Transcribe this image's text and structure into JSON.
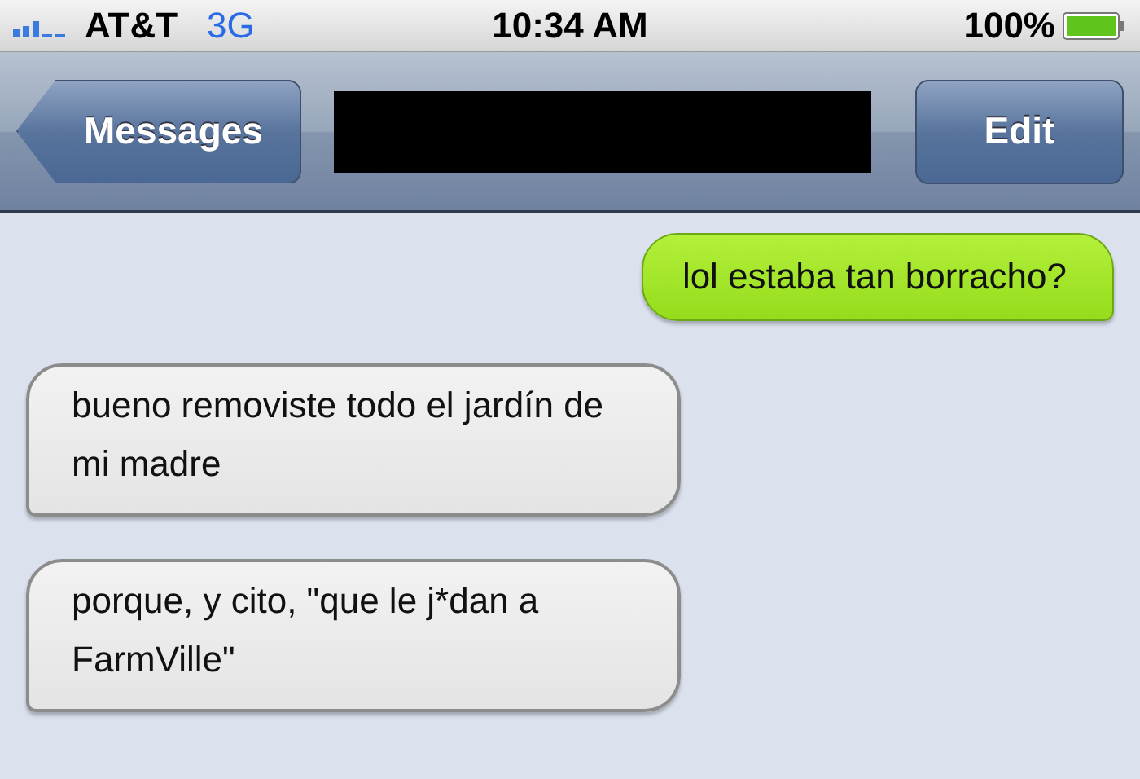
{
  "status_bar": {
    "carrier": "AT&T",
    "network": "3G",
    "time": "10:34 AM",
    "battery": "100%"
  },
  "nav_bar": {
    "back_button": "Messages",
    "edit_button": "Edit"
  },
  "messages": [
    {
      "kind": "sent",
      "text": "lol estaba tan borracho?"
    },
    {
      "kind": "received",
      "text": "bueno removiste todo el jardín de mi madre"
    },
    {
      "kind": "received",
      "text": "porque, y cito, \"que le j*dan a FarmVille\""
    }
  ]
}
